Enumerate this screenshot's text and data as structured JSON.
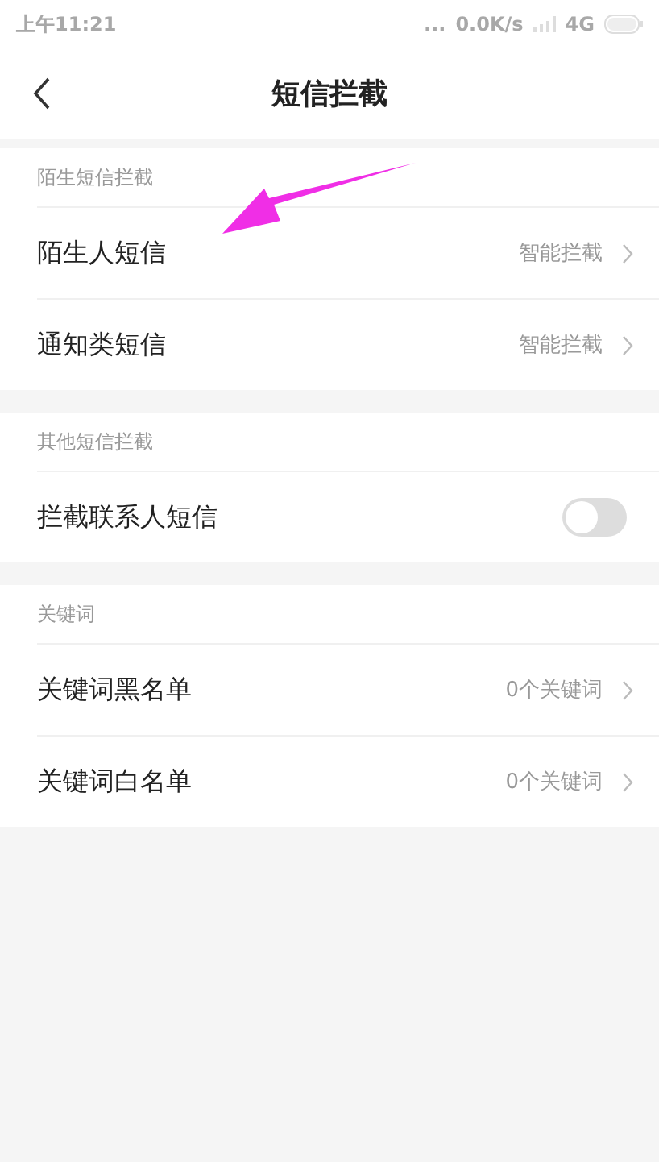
{
  "status_bar": {
    "time": "上午11:21",
    "dots": "...",
    "speed": "0.0K/s",
    "network": "4G"
  },
  "header": {
    "title": "短信拦截"
  },
  "sections": [
    {
      "title": "陌生短信拦截",
      "items": [
        {
          "kind": "link",
          "label": "陌生人短信",
          "value": "智能拦截"
        },
        {
          "kind": "link",
          "label": "通知类短信",
          "value": "智能拦截"
        }
      ]
    },
    {
      "title": "其他短信拦截",
      "items": [
        {
          "kind": "toggle",
          "label": "拦截联系人短信",
          "on": false
        }
      ]
    },
    {
      "title": "关键词",
      "items": [
        {
          "kind": "link",
          "label": "关键词黑名单",
          "value": "0个关键词"
        },
        {
          "kind": "link",
          "label": "关键词白名单",
          "value": "0个关键词"
        }
      ]
    }
  ]
}
